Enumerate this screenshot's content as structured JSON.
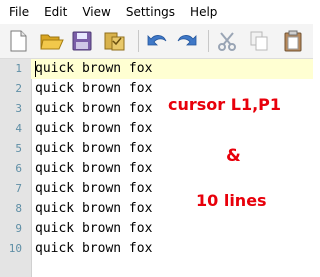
{
  "menu": {
    "items": [
      "File",
      "Edit",
      "View",
      "Settings",
      "Help"
    ]
  },
  "toolbar": {
    "icons": [
      "new-file-icon",
      "open-folder-icon",
      "save-icon",
      "save-all-icon",
      "undo-icon",
      "redo-icon",
      "cut-icon",
      "copy-icon",
      "paste-icon"
    ]
  },
  "editor": {
    "lines": [
      {
        "num": "1",
        "text": "quick brown fox"
      },
      {
        "num": "2",
        "text": "quick brown fox"
      },
      {
        "num": "3",
        "text": "quick brown fox"
      },
      {
        "num": "4",
        "text": "quick brown fox"
      },
      {
        "num": "5",
        "text": "quick brown fox"
      },
      {
        "num": "6",
        "text": "quick brown fox"
      },
      {
        "num": "7",
        "text": "quick brown fox"
      },
      {
        "num": "8",
        "text": "quick brown fox"
      },
      {
        "num": "9",
        "text": "quick brown fox"
      },
      {
        "num": "10",
        "text": "quick brown fox"
      }
    ],
    "current_line": 1
  },
  "annotation": {
    "line1": "cursor L1,P1",
    "line2": "&",
    "line3": "10 lines",
    "color": "#e8000b"
  },
  "colors": {
    "gutter": "#e4e4e4",
    "line_number": "#5f8fa6",
    "current_line": "#ffffd2"
  }
}
